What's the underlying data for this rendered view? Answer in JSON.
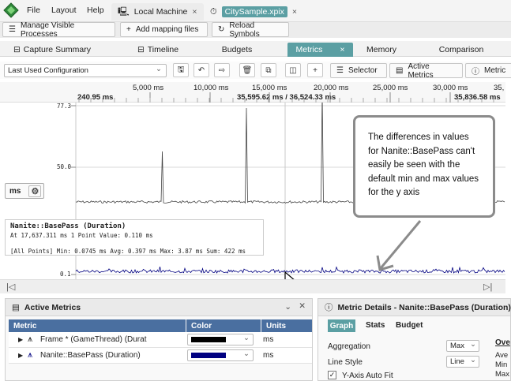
{
  "menubar": {
    "menus": [
      "File",
      "Layout",
      "Help"
    ],
    "tabs": [
      {
        "label": "Local Machine",
        "close": "×"
      },
      {
        "label": "CitySample.xpix",
        "close": "×"
      }
    ]
  },
  "toolbar": {
    "manage_label": "Manage Visible Processes",
    "add_label": "Add mapping files",
    "reload_label": "Reload Symbols"
  },
  "views": {
    "capture_summary": "Capture Summary",
    "timeline": "Timeline",
    "budgets": "Budgets",
    "metrics": "Metrics",
    "memory": "Memory",
    "comparison": "Comparison",
    "close": "×"
  },
  "controls": {
    "config": "Last Used Configuration",
    "selector": "Selector",
    "active_metrics": "Active Metrics",
    "metric_details": "Metric"
  },
  "ruler": {
    "ticks": [
      "5,000 ms",
      "10,000 ms",
      "15,000 ms",
      "20,000 ms",
      "25,000 ms",
      "30,000 ms",
      "35,"
    ],
    "start": "240.95 ms",
    "range": "35,595.62 ms / 36,524.33 ms",
    "end": "35,836.58 ms"
  },
  "graph": {
    "y_labels": [
      "77.3",
      "50.0",
      "0.1"
    ],
    "unit_button": "ms",
    "colors": {
      "frame_line": "#444444",
      "basepass_line": "#000080"
    }
  },
  "infobox": {
    "title": "Nanite::BasePass (Duration)",
    "line1": "At 17,637.311 ms  1 Point  Value: 0.110 ms",
    "line2": "[All Points]  Min: 0.0745 ms  Avg: 0.397 ms  Max: 3.87 ms  Sum: 422 ms"
  },
  "callout": {
    "text": "The differences in values for Nanite::BasePass can't easily be seen with the default min and max values for the y axis"
  },
  "active_metrics": {
    "title": "Active Metrics",
    "columns": [
      "Metric",
      "Color",
      "Units"
    ],
    "rows": [
      {
        "name": "Frame * (GameThread) (Durat",
        "color": "#000000",
        "units": "ms"
      },
      {
        "name": "Nanite::BasePass (Duration)",
        "color": "#000080",
        "units": "ms"
      }
    ]
  },
  "metric_details": {
    "title": "Metric Details - Nanite::BasePass (Duration)",
    "tabs": [
      "Graph",
      "Stats",
      "Budget"
    ],
    "aggregation_label": "Aggregation",
    "aggregation_value": "Max",
    "line_style_label": "Line Style",
    "line_style_value": "Line",
    "y_axis_auto_fit": "Y-Axis Auto Fit",
    "overlay_title": "Ove",
    "overlay_items": [
      "Ave",
      "Min",
      "Max"
    ]
  }
}
